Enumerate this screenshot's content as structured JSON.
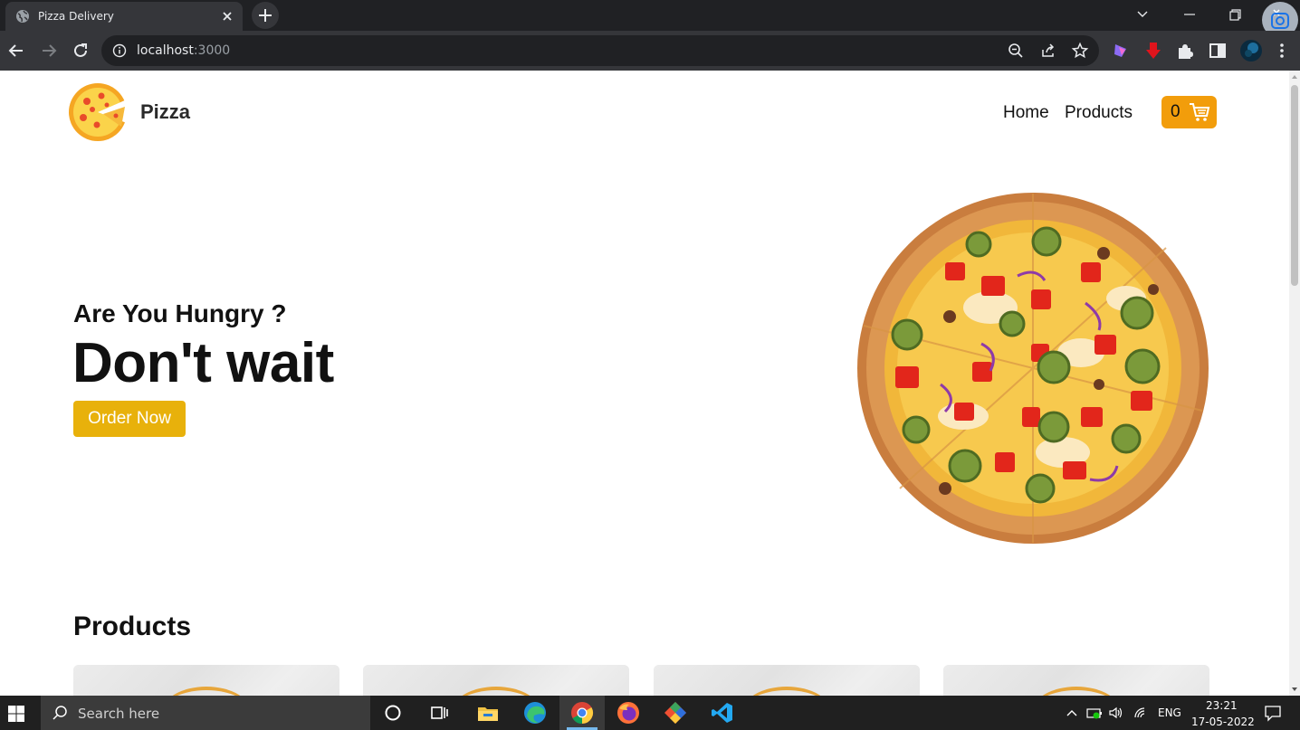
{
  "browser": {
    "tab_title": "Pizza Delivery",
    "url_host": "localhost",
    "url_port": ":3000"
  },
  "site": {
    "brand": "Pizza",
    "nav": [
      {
        "label": "Home"
      },
      {
        "label": "Products"
      }
    ],
    "cart_count": "0",
    "hero": {
      "subtitle": "Are You Hungry ?",
      "title": "Don't wait",
      "cta": "Order Now"
    },
    "products_heading": "Products",
    "product_cards": 4
  },
  "taskbar": {
    "search_placeholder": "Search here",
    "language": "ENG",
    "time": "23:21",
    "date": "17-05-2022"
  },
  "colors": {
    "cart_button": "#f29d0b",
    "order_button": "#e8b10b",
    "browser_frame": "#202124",
    "toolbar": "#35363a"
  },
  "icons": [
    "globe-icon",
    "close-icon",
    "plus-icon",
    "chevron-down-icon",
    "minimize-icon",
    "restore-icon",
    "close-window-icon",
    "back-icon",
    "forward-icon",
    "reload-icon",
    "info-icon",
    "zoom-icon",
    "share-icon",
    "star-icon",
    "extension-icon",
    "download-icon",
    "puzzle-icon",
    "sidepanel-icon",
    "avatar",
    "menu-icon",
    "cart-icon",
    "windows-icon",
    "search-icon",
    "cortana-icon",
    "taskview-icon",
    "explorer-icon",
    "edge-icon",
    "chrome-icon",
    "firefox-icon",
    "git-icon",
    "vscode-icon",
    "wifi-icon",
    "volume-icon",
    "battery-icon",
    "notification-icon"
  ]
}
